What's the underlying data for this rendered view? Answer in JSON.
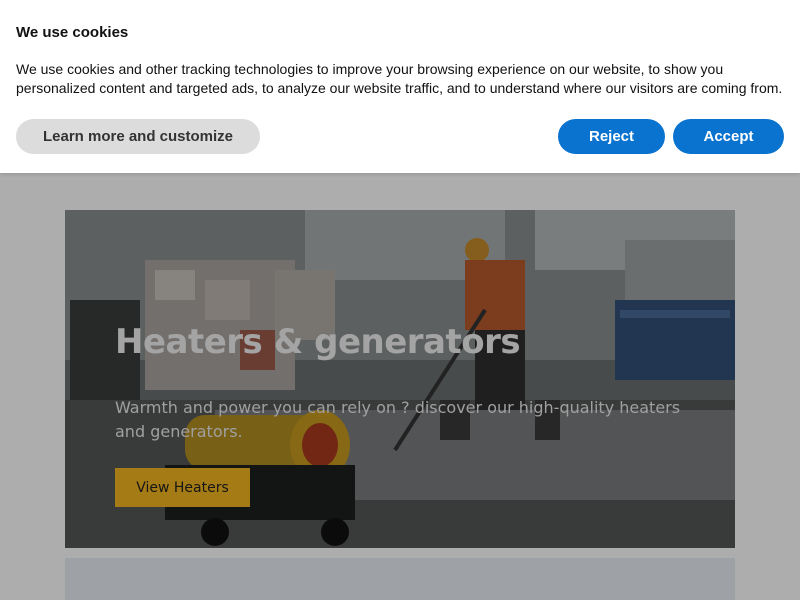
{
  "cookie_banner": {
    "title": "We use cookies",
    "text": "We use cookies and other tracking technologies to improve your browsing experience on our website, to show you personalized content and targeted ads, to analyze our website traffic, and to understand where our visitors are coming from.",
    "learn_more_label": "Learn more and customize",
    "reject_label": "Reject",
    "accept_label": "Accept",
    "accent_color": "#0a73d0"
  },
  "hero": {
    "title": "Heaters & generators",
    "subtitle": "Warmth and power you can rely on ? discover our high-quality heaters and generators.",
    "button_label": "View Heaters",
    "button_color": "#f2b51f"
  }
}
